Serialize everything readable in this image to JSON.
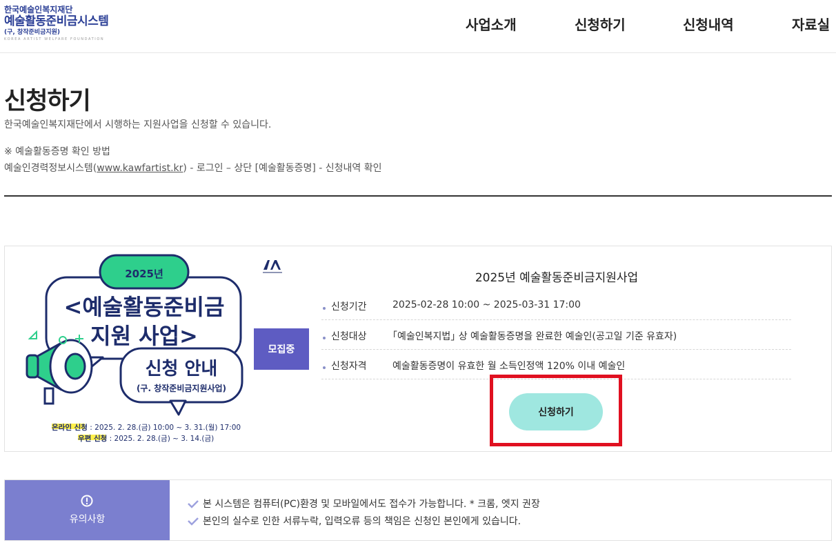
{
  "header": {
    "logo": {
      "line1": "한국예술인복지재단",
      "line2": "예술활동준비금시스템",
      "line3": "(구, 창작준비금지원)",
      "line4": "KOREA ARTIST WELFARE FOUNDATION"
    },
    "nav": [
      "사업소개",
      "신청하기",
      "신청내역",
      "자료실"
    ]
  },
  "page": {
    "title": "신청하기",
    "description": "한국예술인복지재단에서 시행하는 지원사업을 신청할 수 있습니다.",
    "note_title": "※ 예술활동증명 확인 방법",
    "note_prefix": "예술인경력정보시스템(",
    "note_link": "www.kawfartist.kr",
    "note_suffix": ") - 로그인 – 상단 [예술활동증명] - 신청내역 확인"
  },
  "program": {
    "poster": {
      "year": "2025년",
      "title_line1": "<예술활동준비금",
      "title_line2": "지원 사업>",
      "subtitle": "신청 안내",
      "sub_note": "(구. 창작준비금지원사업)",
      "online_label": "온라인 신청",
      "online_period": " : 2025. 2. 28.(금) 10:00 ~ 3. 31.(월) 17:00",
      "mail_label": "우편 신청",
      "mail_period": " : 2025. 2. 28.(금) ~ 3. 14.(금)"
    },
    "status_badge": "모집중",
    "title": "2025년 예술활동준비금지원사업",
    "rows": [
      {
        "label": "신청기간",
        "value": "2025-02-28 10:00 ~ 2025-03-31 17:00"
      },
      {
        "label": "신청대상",
        "value": "｢예술인복지법｣ 상 예술활동증명을 완료한 예술인(공고일 기준 유효자)"
      },
      {
        "label": "신청자격",
        "value": "예술활동증명이 유효한 월 소득인정액 120% 이내 예술인"
      }
    ],
    "apply_button": "신청하기"
  },
  "notice": {
    "label": "유의사항",
    "items": [
      "본 시스템은 컴퓨터(PC)환경 및 모바일에서도 접수가 가능합니다. * 크롬, 엣지 권장",
      "본인의 실수로 인한 서류누락, 입력오류 등의 책임은 신청인 본인에게 있습니다."
    ]
  },
  "colors": {
    "brand_navy": "#2b3f96",
    "badge_purple": "#5e5cc2",
    "notice_purple": "#7b7fcf",
    "apply_mint": "#9fe7e0",
    "highlight_red": "#e01020",
    "poster_green": "#2ecf8c"
  }
}
